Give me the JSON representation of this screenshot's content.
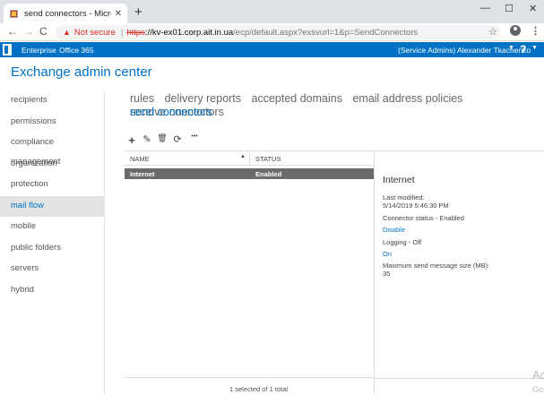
{
  "browser": {
    "tab_title": "send connectors - Microsoft Exc",
    "tab_close": "✕",
    "new_tab": "+",
    "window_controls": [
      "—",
      "☐",
      "✕"
    ],
    "nav": {
      "back": "←",
      "forward": "→",
      "reload": "C"
    },
    "not_secure": "Not secure",
    "url_scheme": "https",
    "url_host": "://kv-ex01.corp.ait.in.ua",
    "url_path": "/ecp/default.aspx?exsvurl=1&p=SendConnectors",
    "star": "☆",
    "menu": "⋮"
  },
  "o365": {
    "enterprise": "Enterprise",
    "office365": "Office 365",
    "user": "(Service Admins) Alexander Tkachenko",
    "help": "?"
  },
  "header": {
    "title": "Exchange admin center"
  },
  "leftnav": {
    "items": [
      {
        "label": "recipients"
      },
      {
        "label": "permissions"
      },
      {
        "label": "compliance management"
      },
      {
        "label": "organization"
      },
      {
        "label": "protection"
      },
      {
        "label": "mail flow"
      },
      {
        "label": "mobile"
      },
      {
        "label": "public folders"
      },
      {
        "label": "servers"
      },
      {
        "label": "hybrid"
      }
    ],
    "active": "mail flow"
  },
  "subtabs": {
    "items": [
      {
        "label": "rules"
      },
      {
        "label": "delivery reports"
      },
      {
        "label": "accepted domains"
      },
      {
        "label": "email address policies"
      },
      {
        "label": "receive connectors"
      },
      {
        "label": "send connectors"
      }
    ],
    "selected": "send connectors"
  },
  "toolbar": {
    "icons": [
      "add-icon",
      "edit-icon",
      "delete-icon",
      "refresh-icon",
      "more-icon"
    ],
    "add": "+",
    "edit": "✎",
    "delete": "🗑",
    "refresh": "⟳",
    "more": "•••"
  },
  "grid": {
    "columns": [
      "NAME",
      "STATUS"
    ],
    "sort_indicator": "▲",
    "rows": [
      {
        "name": "Internet",
        "status": "Enabled"
      }
    ],
    "status_text": "1 selected of 1 total"
  },
  "details": {
    "title": "Internet",
    "last_modified_label": "Last modified:",
    "last_modified_value": "5/14/2019 5:46:30 PM",
    "connector_status": "Connector status - Enabled",
    "disable_link": "Disable",
    "logging": "Logging - Off",
    "on_link": "On",
    "max_size_label": "Maximum send message size (MB):",
    "max_size_value": "35"
  },
  "watermark": {
    "line1": "Ac",
    "line2": "Go"
  },
  "colors": {
    "accent": "#0072c6",
    "selected_row": "#6b6b6b",
    "warning": "#d93025"
  }
}
